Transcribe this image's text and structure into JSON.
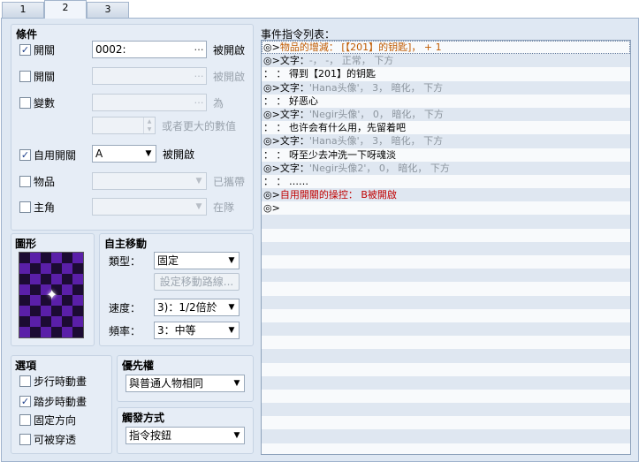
{
  "tabs": [
    {
      "label": "1"
    },
    {
      "label": "2"
    },
    {
      "label": "3"
    }
  ],
  "conditions": {
    "title": "條件",
    "switch1": {
      "label": "開關",
      "checked": true,
      "value": "0002:",
      "suffix": "被開啟"
    },
    "switch2": {
      "label": "開關",
      "checked": false,
      "value": "",
      "suffix": "被開啟"
    },
    "variable": {
      "label": "變數",
      "checked": false,
      "value": "",
      "suffix": "為",
      "number_suffix": "或者更大的數值"
    },
    "self_switch": {
      "label": "自用開關",
      "checked": true,
      "value": "A",
      "suffix": "被開啟"
    },
    "item": {
      "label": "物品",
      "checked": false,
      "value": "",
      "suffix": "已攜帶"
    },
    "actor": {
      "label": "主角",
      "checked": false,
      "value": "",
      "suffix": "在隊"
    }
  },
  "graphic": {
    "title": "圖形"
  },
  "autonomous": {
    "title": "自主移動",
    "type_label": "類型：",
    "type_value": "固定",
    "route_button": "設定移動路線...",
    "speed_label": "速度：",
    "speed_value": "3)：1/2倍於",
    "freq_label": "頻率：",
    "freq_value": "3：中等"
  },
  "options": {
    "title": "選項",
    "items": [
      {
        "label": "步行時動畫",
        "checked": false
      },
      {
        "label": "踏步時動畫",
        "checked": true
      },
      {
        "label": "固定方向",
        "checked": false
      },
      {
        "label": "可被穿透",
        "checked": false
      }
    ]
  },
  "priority": {
    "title": "優先權",
    "value": "與普通人物相同"
  },
  "trigger": {
    "title": "觸發方式",
    "value": "指令按鈕"
  },
  "command_list": {
    "title": "事件指令列表：",
    "rows": [
      {
        "parts": [
          {
            "t": "◎>",
            "c": "black"
          },
          {
            "t": "物品的增減： [【201】的钥匙]， + 1",
            "c": "orange"
          }
        ]
      },
      {
        "parts": [
          {
            "t": "◎>文字：",
            "c": "black"
          },
          {
            "t": "-， -， 正常， 下方",
            "c": "gray"
          }
        ]
      },
      {
        "parts": [
          {
            "t": " ：    ：  得到【201】的钥匙",
            "c": "black"
          }
        ]
      },
      {
        "parts": [
          {
            "t": "◎>文字：",
            "c": "black"
          },
          {
            "t": "'Hana头像'， 3， 暗化， 下方",
            "c": "gray"
          }
        ]
      },
      {
        "parts": [
          {
            "t": " ：    ：  好恶心",
            "c": "black"
          }
        ]
      },
      {
        "parts": [
          {
            "t": "◎>文字：",
            "c": "black"
          },
          {
            "t": "'Negir头像'， 0， 暗化， 下方",
            "c": "gray"
          }
        ]
      },
      {
        "parts": [
          {
            "t": " ：    ：  也许会有什么用，先留着吧",
            "c": "black"
          }
        ]
      },
      {
        "parts": [
          {
            "t": "◎>文字：",
            "c": "black"
          },
          {
            "t": "'Hana头像'， 3， 暗化， 下方",
            "c": "gray"
          }
        ]
      },
      {
        "parts": [
          {
            "t": " ：    ：  呀至少去冲洗一下呀魂淡",
            "c": "black"
          }
        ]
      },
      {
        "parts": [
          {
            "t": "◎>文字：",
            "c": "black"
          },
          {
            "t": "'Negir头像2'， 0， 暗化， 下方",
            "c": "gray"
          }
        ]
      },
      {
        "parts": [
          {
            "t": " ：    ：  ……",
            "c": "black"
          }
        ]
      },
      {
        "parts": [
          {
            "t": "◎>",
            "c": "black"
          },
          {
            "t": "自用開關的操控： B被開啟",
            "c": "red"
          }
        ]
      },
      {
        "parts": [
          {
            "t": "◎>",
            "c": "black"
          }
        ]
      }
    ],
    "total_rows": 31
  }
}
